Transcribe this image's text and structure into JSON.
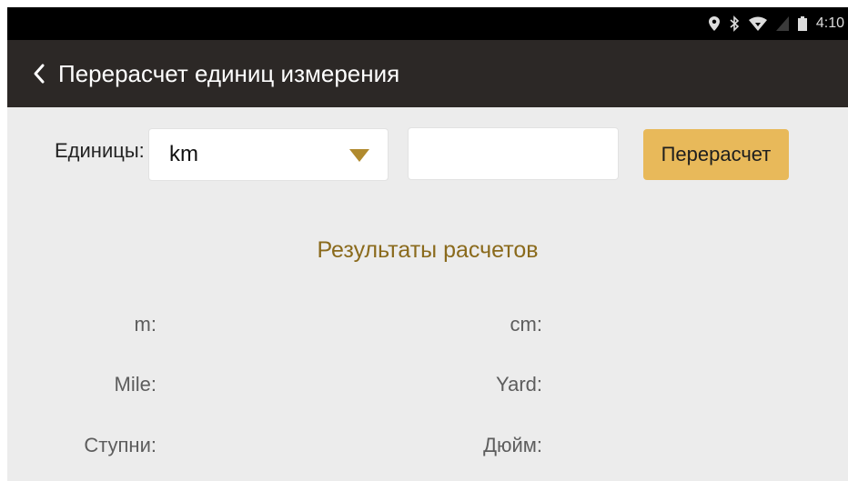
{
  "status_bar": {
    "time": "4:10",
    "icons": [
      "location-icon",
      "bluetooth-icon",
      "wifi-icon",
      "signal-icon",
      "battery-icon"
    ]
  },
  "app_bar": {
    "title": "Перерасчет единиц измерения",
    "back_icon": "chevron-left-icon"
  },
  "form": {
    "units_label": "Единицы:",
    "unit_select_value": "km",
    "value_input": "",
    "value_placeholder": "",
    "recalc_label": "Перерасчет"
  },
  "results": {
    "title": "Результаты расчетов",
    "labels": {
      "m": "m:",
      "cm": "cm:",
      "mile": "Mile:",
      "yard": "Yard:",
      "feet": "Ступни:",
      "inch": "Дюйм:"
    }
  },
  "colors": {
    "status_bar": "#000000",
    "app_bar": "#2c2826",
    "background": "#ececec",
    "accent_button": "#e8b95a",
    "dropdown_arrow": "#b08a2e",
    "results_title": "#8a6a1c"
  }
}
